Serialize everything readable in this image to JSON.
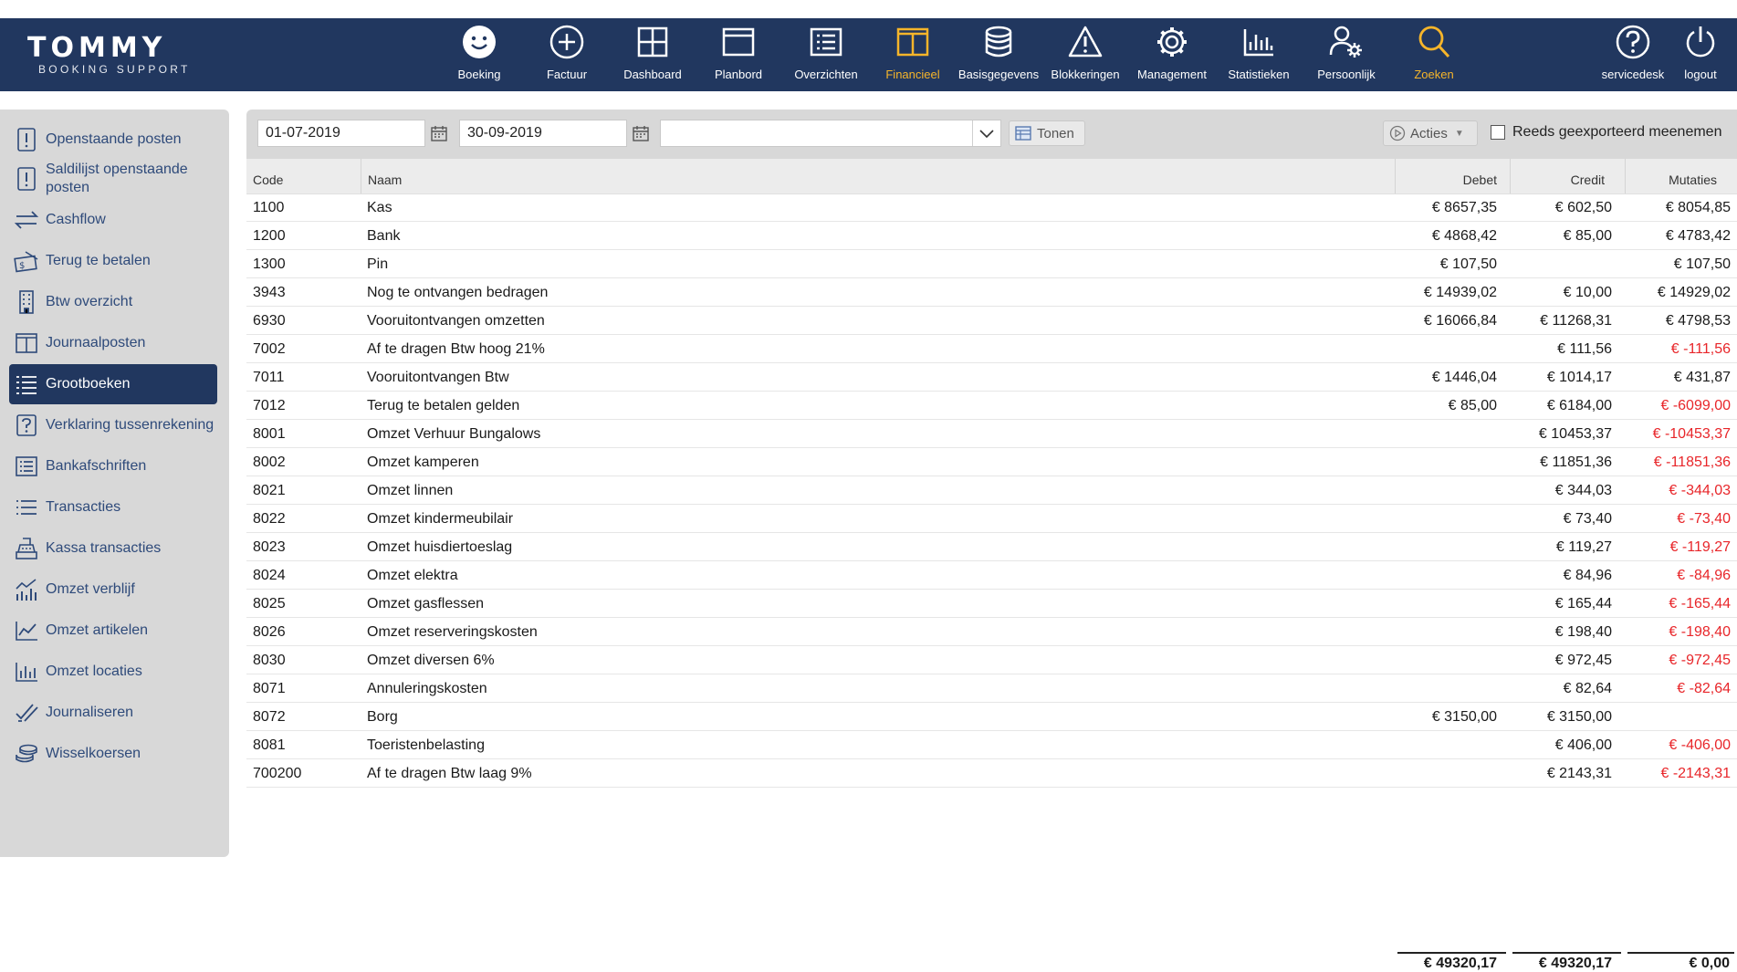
{
  "brand": {
    "name": "TOMMY",
    "tagline": "BOOKING SUPPORT"
  },
  "nav": {
    "items": [
      {
        "label": "Boeking",
        "icon": "smiley-icon"
      },
      {
        "label": "Factuur",
        "icon": "plus-circle-icon"
      },
      {
        "label": "Dashboard",
        "icon": "grid-icon"
      },
      {
        "label": "Planbord",
        "icon": "window-icon"
      },
      {
        "label": "Overzichten",
        "icon": "list-box-icon"
      },
      {
        "label": "Financieel",
        "icon": "columns-icon"
      },
      {
        "label": "Basisgegevens",
        "icon": "database-icon"
      },
      {
        "label": "Blokkeringen",
        "icon": "warning-icon"
      },
      {
        "label": "Management",
        "icon": "gear-icon"
      },
      {
        "label": "Statistieken",
        "icon": "bar-chart-icon"
      },
      {
        "label": "Persoonlijk",
        "icon": "user-gear-icon"
      },
      {
        "label": "Zoeken",
        "icon": "search-icon"
      }
    ],
    "right": [
      {
        "label": "servicedesk",
        "icon": "question-circle-icon"
      },
      {
        "label": "logout",
        "icon": "power-icon"
      }
    ],
    "active_color": "#f6b52a"
  },
  "sidebar": {
    "items": [
      {
        "label": "Openstaande posten",
        "icon": "exclamation-doc-icon"
      },
      {
        "label": "Saldilijst openstaande posten",
        "icon": "exclamation-doc-icon"
      },
      {
        "label": "Cashflow",
        "icon": "arrows-exchange-icon"
      },
      {
        "label": "Terug te betalen",
        "icon": "money-bill-icon"
      },
      {
        "label": "Btw overzicht",
        "icon": "building-icon"
      },
      {
        "label": "Journaalposten",
        "icon": "columns-icon"
      },
      {
        "label": "Grootboeken",
        "icon": "ledger-list-icon"
      },
      {
        "label": "Verklaring tussenrekening",
        "icon": "question-box-icon"
      },
      {
        "label": "Bankafschriften",
        "icon": "list-box-icon"
      },
      {
        "label": "Transacties",
        "icon": "list-icon"
      },
      {
        "label": "Kassa transacties",
        "icon": "cash-register-icon"
      },
      {
        "label": "Omzet verblijf",
        "icon": "chart-bars-line-icon"
      },
      {
        "label": "Omzet artikelen",
        "icon": "line-chart-icon"
      },
      {
        "label": "Omzet locaties",
        "icon": "bar-chart-icon"
      },
      {
        "label": "Journaliseren",
        "icon": "double-check-icon"
      },
      {
        "label": "Wisselkoersen",
        "icon": "coins-icon"
      }
    ],
    "active_index": 6
  },
  "toolbar": {
    "date_from": "01-07-2019",
    "date_to": "30-09-2019",
    "select_value": "",
    "show_label": "Tonen",
    "actions_label": "Acties",
    "export_label": "Reeds geexporteerd meenemen",
    "export_checked": false
  },
  "table": {
    "columns": [
      "Code",
      "Naam",
      "Debet",
      "Credit",
      "Mutaties"
    ],
    "rows": [
      {
        "code": "1100",
        "naam": "Kas",
        "debet": "€ 8657,35",
        "credit": "€ 602,50",
        "mutaties": "€ 8054,85",
        "neg": false
      },
      {
        "code": "1200",
        "naam": "Bank",
        "debet": "€ 4868,42",
        "credit": "€ 85,00",
        "mutaties": "€ 4783,42",
        "neg": false
      },
      {
        "code": "1300",
        "naam": "Pin",
        "debet": "€ 107,50",
        "credit": "",
        "mutaties": "€ 107,50",
        "neg": false
      },
      {
        "code": "3943",
        "naam": "Nog te ontvangen bedragen",
        "debet": "€ 14939,02",
        "credit": "€ 10,00",
        "mutaties": "€ 14929,02",
        "neg": false
      },
      {
        "code": "6930",
        "naam": "Vooruitontvangen omzetten",
        "debet": "€ 16066,84",
        "credit": "€ 11268,31",
        "mutaties": "€ 4798,53",
        "neg": false
      },
      {
        "code": "7002",
        "naam": "Af te dragen Btw hoog 21%",
        "debet": "",
        "credit": "€ 111,56",
        "mutaties": "€ -111,56",
        "neg": true
      },
      {
        "code": "7011",
        "naam": "Vooruitontvangen Btw",
        "debet": "€ 1446,04",
        "credit": "€ 1014,17",
        "mutaties": "€ 431,87",
        "neg": false
      },
      {
        "code": "7012",
        "naam": "Terug te betalen gelden",
        "debet": "€ 85,00",
        "credit": "€ 6184,00",
        "mutaties": "€ -6099,00",
        "neg": true
      },
      {
        "code": "8001",
        "naam": "Omzet Verhuur Bungalows",
        "debet": "",
        "credit": "€ 10453,37",
        "mutaties": "€ -10453,37",
        "neg": true
      },
      {
        "code": "8002",
        "naam": "Omzet kamperen",
        "debet": "",
        "credit": "€ 11851,36",
        "mutaties": "€ -11851,36",
        "neg": true
      },
      {
        "code": "8021",
        "naam": "Omzet linnen",
        "debet": "",
        "credit": "€ 344,03",
        "mutaties": "€ -344,03",
        "neg": true
      },
      {
        "code": "8022",
        "naam": "Omzet kindermeubilair",
        "debet": "",
        "credit": "€ 73,40",
        "mutaties": "€ -73,40",
        "neg": true
      },
      {
        "code": "8023",
        "naam": "Omzet huisdiertoeslag",
        "debet": "",
        "credit": "€ 119,27",
        "mutaties": "€ -119,27",
        "neg": true
      },
      {
        "code": "8024",
        "naam": "Omzet elektra",
        "debet": "",
        "credit": "€ 84,96",
        "mutaties": "€ -84,96",
        "neg": true
      },
      {
        "code": "8025",
        "naam": "Omzet gasflessen",
        "debet": "",
        "credit": "€ 165,44",
        "mutaties": "€ -165,44",
        "neg": true
      },
      {
        "code": "8026",
        "naam": "Omzet reserveringskosten",
        "debet": "",
        "credit": "€ 198,40",
        "mutaties": "€ -198,40",
        "neg": true
      },
      {
        "code": "8030",
        "naam": "Omzet diversen 6%",
        "debet": "",
        "credit": "€ 972,45",
        "mutaties": "€ -972,45",
        "neg": true
      },
      {
        "code": "8071",
        "naam": "Annuleringskosten",
        "debet": "",
        "credit": "€ 82,64",
        "mutaties": "€ -82,64",
        "neg": true
      },
      {
        "code": "8072",
        "naam": "Borg",
        "debet": "€ 3150,00",
        "credit": "€ 3150,00",
        "mutaties": "",
        "neg": false
      },
      {
        "code": "8081",
        "naam": "Toeristenbelasting",
        "debet": "",
        "credit": "€ 406,00",
        "mutaties": "€ -406,00",
        "neg": true
      },
      {
        "code": "700200",
        "naam": "Af te dragen Btw laag 9%",
        "debet": "",
        "credit": "€ 2143,31",
        "mutaties": "€ -2143,31",
        "neg": true
      }
    ],
    "totals": {
      "debet": "€ 49320,17",
      "credit": "€ 49320,17",
      "mutaties": "€ 0,00"
    },
    "negative_color": "#e8262a"
  },
  "colors": {
    "header_bg": "#21375f",
    "sidebar_bg": "#d8d8d8",
    "sidebar_text": "#2e4a7a"
  }
}
